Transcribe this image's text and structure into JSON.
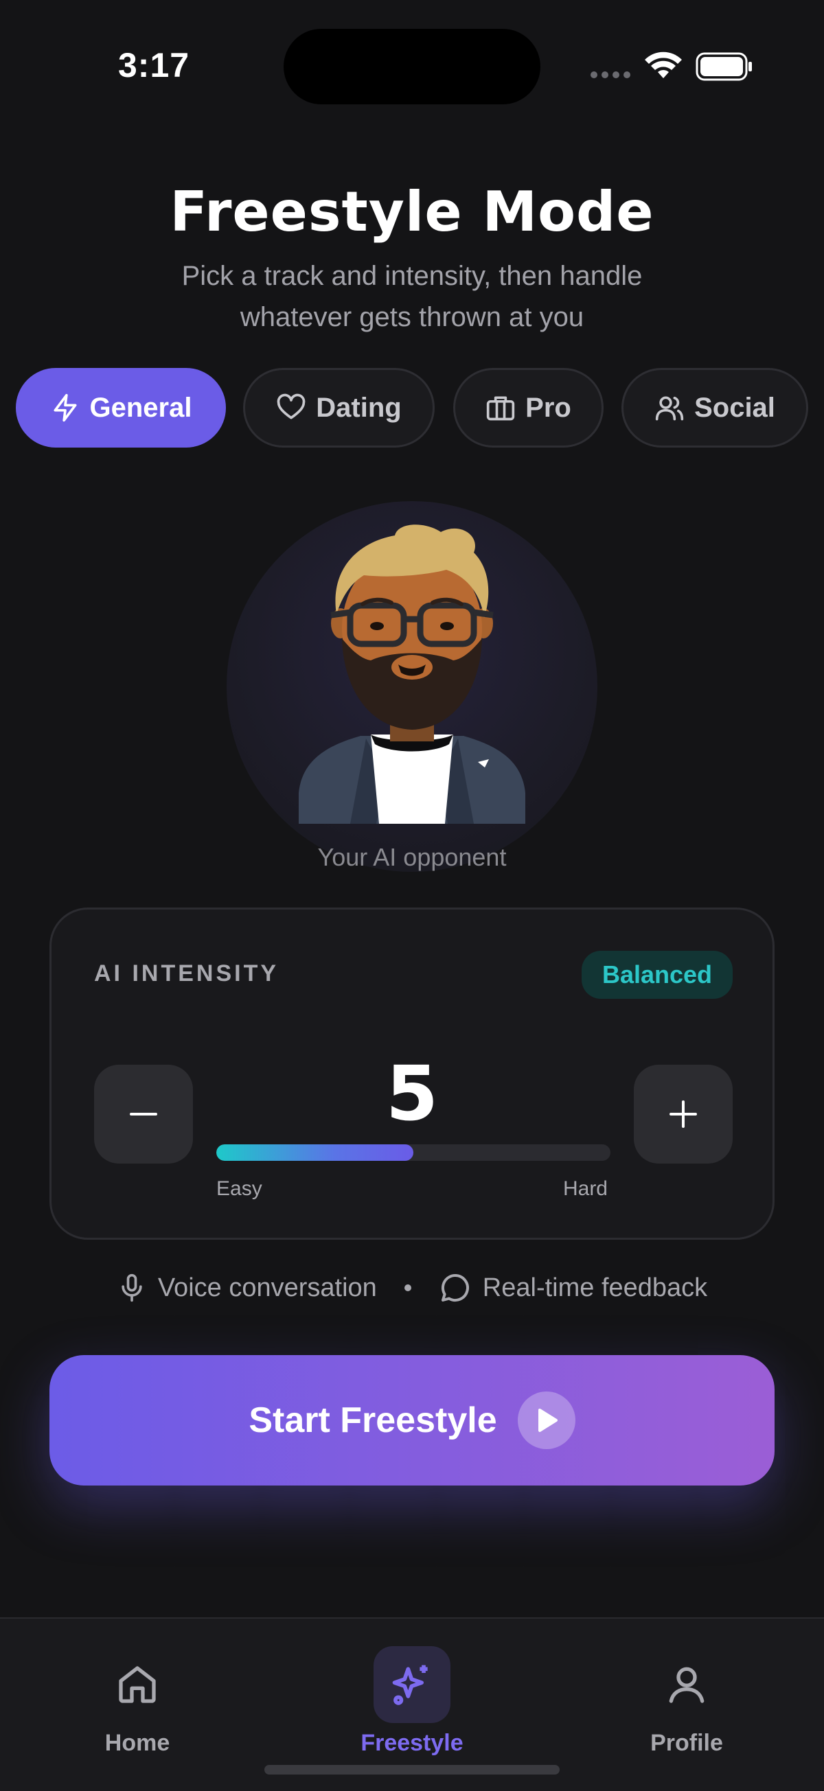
{
  "status_bar": {
    "time": "3:17"
  },
  "header": {
    "title": "Freestyle Mode",
    "subtitle": "Pick a track and intensity, then handle whatever gets thrown at you"
  },
  "tabs": [
    {
      "label": "General",
      "icon": "lightning-icon",
      "active": true
    },
    {
      "label": "Dating",
      "icon": "heart-icon",
      "active": false
    },
    {
      "label": "Pro",
      "icon": "briefcase-icon",
      "active": false
    },
    {
      "label": "Social",
      "icon": "users-icon",
      "active": false
    }
  ],
  "opponent": {
    "label": "Your AI opponent"
  },
  "intensity": {
    "label": "AI INTENSITY",
    "badge": "Balanced",
    "value": "5",
    "level": 0.5,
    "min_label": "Easy",
    "max_label": "Hard"
  },
  "features": {
    "voice": "Voice conversation",
    "feedback": "Real-time feedback"
  },
  "cta": {
    "label": "Start Freestyle"
  },
  "nav": {
    "home": "Home",
    "freestyle": "Freestyle",
    "profile": "Profile"
  },
  "colors": {
    "accent": "#6b5ce7",
    "teal": "#2cc7c8",
    "background": "#141416"
  }
}
